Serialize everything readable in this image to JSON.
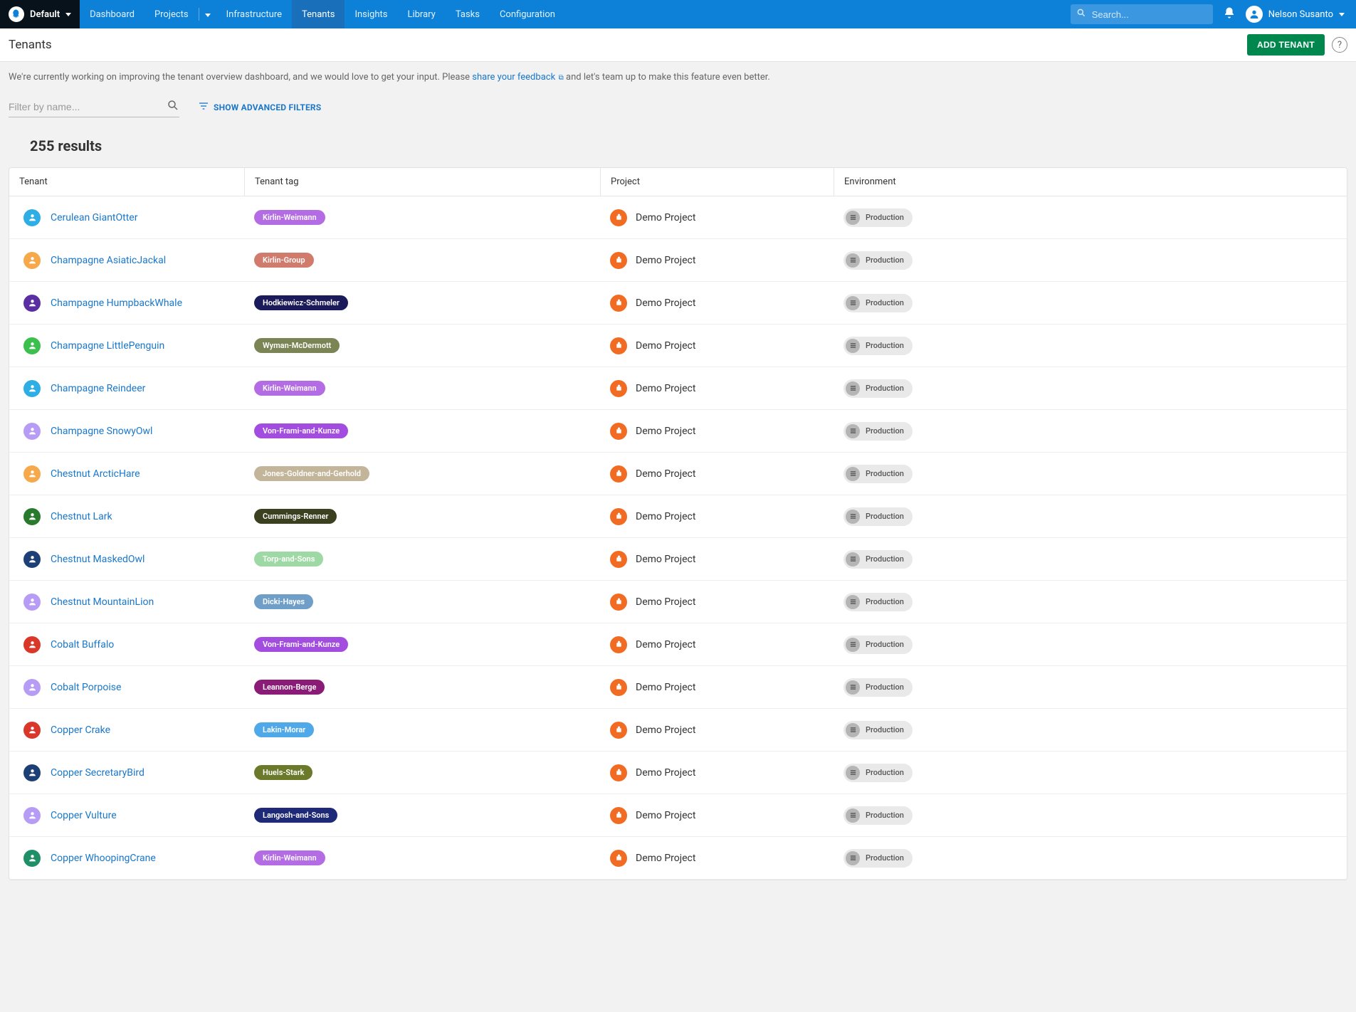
{
  "topbar": {
    "space_name": "Default",
    "nav": {
      "dashboard": "Dashboard",
      "projects": "Projects",
      "infrastructure": "Infrastructure",
      "tenants": "Tenants",
      "insights": "Insights",
      "library": "Library",
      "tasks": "Tasks",
      "configuration": "Configuration"
    },
    "search_placeholder": "Search...",
    "user_name": "Nelson Susanto"
  },
  "header": {
    "title": "Tenants",
    "add_button": "ADD TENANT"
  },
  "banner": {
    "pre": "We're currently working on improving the tenant overview dashboard, and we would love to get your input. Please ",
    "link": "share your feedback",
    "post": " and let's team up to make this feature even better."
  },
  "filters": {
    "placeholder": "Filter by name...",
    "advanced_label": "SHOW ADVANCED FILTERS"
  },
  "results_label": "255 results",
  "columns": {
    "tenant": "Tenant",
    "tag": "Tenant tag",
    "project": "Project",
    "environment": "Environment"
  },
  "default_project": "Demo Project",
  "default_env": "Production",
  "tenants": [
    {
      "name": "Cerulean GiantOtter",
      "avatar_bg": "#2eaee5",
      "tag": "Kirlin-Weimann",
      "tag_bg": "#b46ce5"
    },
    {
      "name": "Champagne AsiaticJackal",
      "avatar_bg": "#f5a94b",
      "tag": "Kirlin-Group",
      "tag_bg": "#d17b6d"
    },
    {
      "name": "Champagne HumpbackWhale",
      "avatar_bg": "#5b2ea3",
      "tag": "Hodkiewicz-Schmeler",
      "tag_bg": "#1b1a5a"
    },
    {
      "name": "Champagne LittlePenguin",
      "avatar_bg": "#3bbf4d",
      "tag": "Wyman-McDermott",
      "tag_bg": "#7a8454"
    },
    {
      "name": "Champagne Reindeer",
      "avatar_bg": "#2eaee5",
      "tag": "Kirlin-Weimann",
      "tag_bg": "#b46ce5"
    },
    {
      "name": "Champagne SnowyOwl",
      "avatar_bg": "#b79cf5",
      "tag": "Von-Frami-and-Kunze",
      "tag_bg": "#a24de0"
    },
    {
      "name": "Chestnut ArcticHare",
      "avatar_bg": "#f5a94b",
      "tag": "Jones-Goldner-and-Gerhold",
      "tag_bg": "#c3b59a"
    },
    {
      "name": "Chestnut Lark",
      "avatar_bg": "#2a7a2e",
      "tag": "Cummings-Renner",
      "tag_bg": "#3b4020"
    },
    {
      "name": "Chestnut MaskedOwl",
      "avatar_bg": "#1c3f75",
      "tag": "Torp-and-Sons",
      "tag_bg": "#9ed9a5"
    },
    {
      "name": "Chestnut MountainLion",
      "avatar_bg": "#b79cf5",
      "tag": "Dicki-Hayes",
      "tag_bg": "#6f9fc8"
    },
    {
      "name": "Cobalt Buffalo",
      "avatar_bg": "#d9372a",
      "tag": "Von-Frami-and-Kunze",
      "tag_bg": "#a24de0"
    },
    {
      "name": "Cobalt Porpoise",
      "avatar_bg": "#b79cf5",
      "tag": "Leannon-Berge",
      "tag_bg": "#8a1c78"
    },
    {
      "name": "Copper Crake",
      "avatar_bg": "#d9372a",
      "tag": "Lakin-Morar",
      "tag_bg": "#4fa9e8"
    },
    {
      "name": "Copper SecretaryBird",
      "avatar_bg": "#1c3f75",
      "tag": "Huels-Stark",
      "tag_bg": "#6a7a2a"
    },
    {
      "name": "Copper Vulture",
      "avatar_bg": "#b79cf5",
      "tag": "Langosh-and-Sons",
      "tag_bg": "#1e2a78"
    },
    {
      "name": "Copper WhoopingCrane",
      "avatar_bg": "#1e8f66",
      "tag": "Kirlin-Weimann",
      "tag_bg": "#b46ce5"
    }
  ]
}
